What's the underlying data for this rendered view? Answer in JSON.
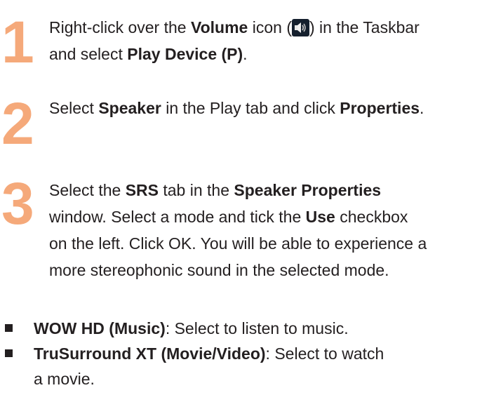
{
  "colors": {
    "step_number": "#f5a97a",
    "text": "#231f20",
    "icon_bg": "#15202e"
  },
  "steps": [
    {
      "number": "1",
      "lines": [
        [
          "Right-click over the ",
          "Volume",
          " icon (",
          "volume-icon",
          ") in the Taskbar"
        ],
        [
          "and select ",
          "Play Device (P)",
          "."
        ]
      ]
    },
    {
      "number": "2",
      "lines": [
        [
          "Select ",
          "Speaker",
          " in the Play tab and click ",
          "Properties",
          "."
        ]
      ]
    },
    {
      "number": "3",
      "lines": [
        [
          "Select the ",
          "SRS",
          " tab in the ",
          "Speaker Properties"
        ],
        [
          "window. Select a mode and tick the ",
          "Use",
          " checkbox"
        ],
        [
          "on the left. Click OK. You will be able to experience a"
        ],
        [
          "more stereophonic sound in the selected mode."
        ]
      ]
    }
  ],
  "bullets": [
    {
      "title": "WOW HD (Music)",
      "text": ": Select to listen to music.",
      "continuation": ""
    },
    {
      "title": "TruSurround XT (Movie/Video)",
      "text": ": Select to watch",
      "continuation": "a movie."
    }
  ]
}
